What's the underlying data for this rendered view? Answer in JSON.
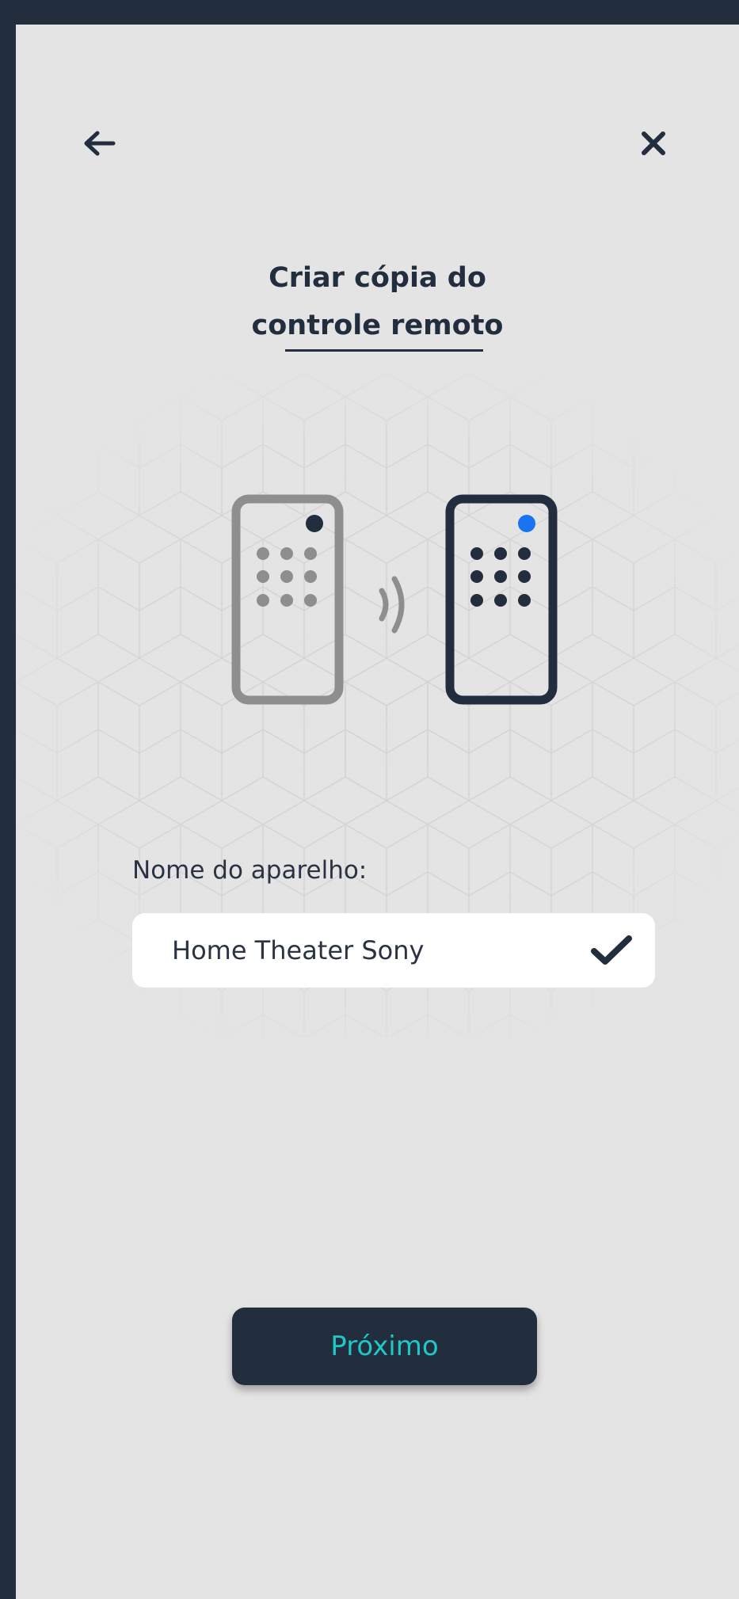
{
  "header": {
    "back_icon": "arrow-left-icon",
    "close_icon": "close-icon",
    "title": "Criar cópia do\ncontrole remoto"
  },
  "illustration": {
    "source_remote_icon": "remote-control-icon",
    "signal_icon": "signal-waves-icon",
    "copy_remote_icon": "remote-control-icon"
  },
  "form": {
    "label": "Nome do aparelho:",
    "value": "Home Theater Sony",
    "check_icon": "check-icon"
  },
  "actions": {
    "next_label": "Próximo"
  },
  "colors": {
    "primary": "#222d3d",
    "background": "#e4e4e4",
    "accent": "#1fc7c7",
    "indicator": "#1a73f0",
    "muted": "#8e8e8e"
  }
}
